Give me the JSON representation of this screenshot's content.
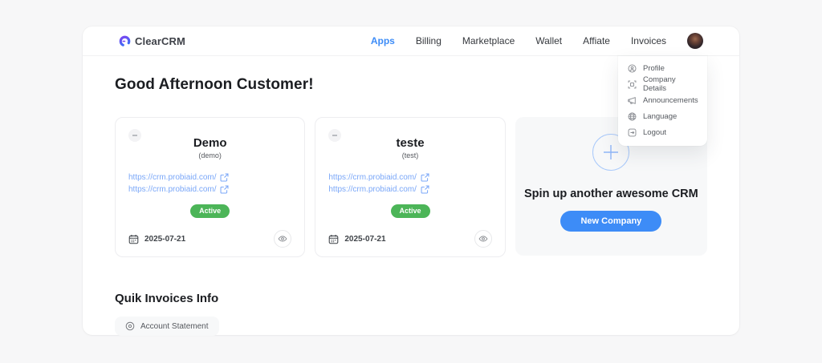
{
  "brand": {
    "name": "ClearCRM"
  },
  "nav": {
    "items": [
      {
        "label": "Apps",
        "active": true
      },
      {
        "label": "Billing",
        "active": false
      },
      {
        "label": "Marketplace",
        "active": false
      },
      {
        "label": "Wallet",
        "active": false
      },
      {
        "label": "Affiate",
        "active": false
      },
      {
        "label": "Invoices",
        "active": false
      }
    ]
  },
  "user_menu": {
    "items": [
      {
        "label": "Profile",
        "icon": "user-circle-icon"
      },
      {
        "label": "Company Details",
        "icon": "company-scan-icon"
      },
      {
        "label": "Announcements",
        "icon": "megaphone-icon"
      },
      {
        "label": "Language",
        "icon": "globe-icon"
      },
      {
        "label": "Logout",
        "icon": "logout-icon"
      }
    ]
  },
  "main": {
    "greeting": "Good Afternoon Customer!"
  },
  "cards": [
    {
      "title": "Demo",
      "subtitle": "(demo)",
      "links": [
        "https://crm.probiaid.com/",
        "https://crm.probiaid.com/"
      ],
      "status": "Active",
      "date": "2025-07-21"
    },
    {
      "title": "teste",
      "subtitle": "(test)",
      "links": [
        "https://crm.probiaid.com/",
        "https://crm.probiaid.com/"
      ],
      "status": "Active",
      "date": "2025-07-21"
    }
  ],
  "new_company_card": {
    "message": "Spin up another awesome CRM",
    "button_label": "New Company"
  },
  "invoices_section": {
    "title": "Quik Invoices Info",
    "button_label": "Account Statement"
  },
  "colors": {
    "accent_blue": "#3d8cf7",
    "link_blue": "#7aa7f8",
    "active_green": "#4cb558",
    "logo_purple": "#7b46f0",
    "logo_blue": "#3d6df5"
  }
}
